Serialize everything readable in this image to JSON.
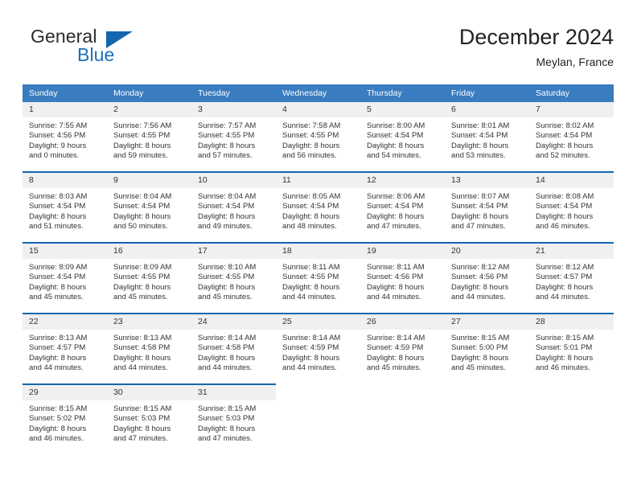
{
  "brand": {
    "word_one": "General",
    "word_two": "Blue",
    "logo_icon": "triangle-logo-icon"
  },
  "header": {
    "title": "December 2024",
    "location": "Meylan, France"
  },
  "colors": {
    "header_blue": "#3a7cc0",
    "rule_blue": "#1466ae",
    "daynum_bg": "#f0f0f0",
    "brand_blue": "#1c6fc0"
  },
  "columns": [
    "Sunday",
    "Monday",
    "Tuesday",
    "Wednesday",
    "Thursday",
    "Friday",
    "Saturday"
  ],
  "weeks": [
    [
      {
        "day": "1",
        "sunrise": "Sunrise: 7:55 AM",
        "sunset": "Sunset: 4:56 PM",
        "daylight_1": "Daylight: 9 hours",
        "daylight_2": "and 0 minutes."
      },
      {
        "day": "2",
        "sunrise": "Sunrise: 7:56 AM",
        "sunset": "Sunset: 4:55 PM",
        "daylight_1": "Daylight: 8 hours",
        "daylight_2": "and 59 minutes."
      },
      {
        "day": "3",
        "sunrise": "Sunrise: 7:57 AM",
        "sunset": "Sunset: 4:55 PM",
        "daylight_1": "Daylight: 8 hours",
        "daylight_2": "and 57 minutes."
      },
      {
        "day": "4",
        "sunrise": "Sunrise: 7:58 AM",
        "sunset": "Sunset: 4:55 PM",
        "daylight_1": "Daylight: 8 hours",
        "daylight_2": "and 56 minutes."
      },
      {
        "day": "5",
        "sunrise": "Sunrise: 8:00 AM",
        "sunset": "Sunset: 4:54 PM",
        "daylight_1": "Daylight: 8 hours",
        "daylight_2": "and 54 minutes."
      },
      {
        "day": "6",
        "sunrise": "Sunrise: 8:01 AM",
        "sunset": "Sunset: 4:54 PM",
        "daylight_1": "Daylight: 8 hours",
        "daylight_2": "and 53 minutes."
      },
      {
        "day": "7",
        "sunrise": "Sunrise: 8:02 AM",
        "sunset": "Sunset: 4:54 PM",
        "daylight_1": "Daylight: 8 hours",
        "daylight_2": "and 52 minutes."
      }
    ],
    [
      {
        "day": "8",
        "sunrise": "Sunrise: 8:03 AM",
        "sunset": "Sunset: 4:54 PM",
        "daylight_1": "Daylight: 8 hours",
        "daylight_2": "and 51 minutes."
      },
      {
        "day": "9",
        "sunrise": "Sunrise: 8:04 AM",
        "sunset": "Sunset: 4:54 PM",
        "daylight_1": "Daylight: 8 hours",
        "daylight_2": "and 50 minutes."
      },
      {
        "day": "10",
        "sunrise": "Sunrise: 8:04 AM",
        "sunset": "Sunset: 4:54 PM",
        "daylight_1": "Daylight: 8 hours",
        "daylight_2": "and 49 minutes."
      },
      {
        "day": "11",
        "sunrise": "Sunrise: 8:05 AM",
        "sunset": "Sunset: 4:54 PM",
        "daylight_1": "Daylight: 8 hours",
        "daylight_2": "and 48 minutes."
      },
      {
        "day": "12",
        "sunrise": "Sunrise: 8:06 AM",
        "sunset": "Sunset: 4:54 PM",
        "daylight_1": "Daylight: 8 hours",
        "daylight_2": "and 47 minutes."
      },
      {
        "day": "13",
        "sunrise": "Sunrise: 8:07 AM",
        "sunset": "Sunset: 4:54 PM",
        "daylight_1": "Daylight: 8 hours",
        "daylight_2": "and 47 minutes."
      },
      {
        "day": "14",
        "sunrise": "Sunrise: 8:08 AM",
        "sunset": "Sunset: 4:54 PM",
        "daylight_1": "Daylight: 8 hours",
        "daylight_2": "and 46 minutes."
      }
    ],
    [
      {
        "day": "15",
        "sunrise": "Sunrise: 8:09 AM",
        "sunset": "Sunset: 4:54 PM",
        "daylight_1": "Daylight: 8 hours",
        "daylight_2": "and 45 minutes."
      },
      {
        "day": "16",
        "sunrise": "Sunrise: 8:09 AM",
        "sunset": "Sunset: 4:55 PM",
        "daylight_1": "Daylight: 8 hours",
        "daylight_2": "and 45 minutes."
      },
      {
        "day": "17",
        "sunrise": "Sunrise: 8:10 AM",
        "sunset": "Sunset: 4:55 PM",
        "daylight_1": "Daylight: 8 hours",
        "daylight_2": "and 45 minutes."
      },
      {
        "day": "18",
        "sunrise": "Sunrise: 8:11 AM",
        "sunset": "Sunset: 4:55 PM",
        "daylight_1": "Daylight: 8 hours",
        "daylight_2": "and 44 minutes."
      },
      {
        "day": "19",
        "sunrise": "Sunrise: 8:11 AM",
        "sunset": "Sunset: 4:56 PM",
        "daylight_1": "Daylight: 8 hours",
        "daylight_2": "and 44 minutes."
      },
      {
        "day": "20",
        "sunrise": "Sunrise: 8:12 AM",
        "sunset": "Sunset: 4:56 PM",
        "daylight_1": "Daylight: 8 hours",
        "daylight_2": "and 44 minutes."
      },
      {
        "day": "21",
        "sunrise": "Sunrise: 8:12 AM",
        "sunset": "Sunset: 4:57 PM",
        "daylight_1": "Daylight: 8 hours",
        "daylight_2": "and 44 minutes."
      }
    ],
    [
      {
        "day": "22",
        "sunrise": "Sunrise: 8:13 AM",
        "sunset": "Sunset: 4:57 PM",
        "daylight_1": "Daylight: 8 hours",
        "daylight_2": "and 44 minutes."
      },
      {
        "day": "23",
        "sunrise": "Sunrise: 8:13 AM",
        "sunset": "Sunset: 4:58 PM",
        "daylight_1": "Daylight: 8 hours",
        "daylight_2": "and 44 minutes."
      },
      {
        "day": "24",
        "sunrise": "Sunrise: 8:14 AM",
        "sunset": "Sunset: 4:58 PM",
        "daylight_1": "Daylight: 8 hours",
        "daylight_2": "and 44 minutes."
      },
      {
        "day": "25",
        "sunrise": "Sunrise: 8:14 AM",
        "sunset": "Sunset: 4:59 PM",
        "daylight_1": "Daylight: 8 hours",
        "daylight_2": "and 44 minutes."
      },
      {
        "day": "26",
        "sunrise": "Sunrise: 8:14 AM",
        "sunset": "Sunset: 4:59 PM",
        "daylight_1": "Daylight: 8 hours",
        "daylight_2": "and 45 minutes."
      },
      {
        "day": "27",
        "sunrise": "Sunrise: 8:15 AM",
        "sunset": "Sunset: 5:00 PM",
        "daylight_1": "Daylight: 8 hours",
        "daylight_2": "and 45 minutes."
      },
      {
        "day": "28",
        "sunrise": "Sunrise: 8:15 AM",
        "sunset": "Sunset: 5:01 PM",
        "daylight_1": "Daylight: 8 hours",
        "daylight_2": "and 46 minutes."
      }
    ],
    [
      {
        "day": "29",
        "sunrise": "Sunrise: 8:15 AM",
        "sunset": "Sunset: 5:02 PM",
        "daylight_1": "Daylight: 8 hours",
        "daylight_2": "and 46 minutes."
      },
      {
        "day": "30",
        "sunrise": "Sunrise: 8:15 AM",
        "sunset": "Sunset: 5:03 PM",
        "daylight_1": "Daylight: 8 hours",
        "daylight_2": "and 47 minutes."
      },
      {
        "day": "31",
        "sunrise": "Sunrise: 8:15 AM",
        "sunset": "Sunset: 5:03 PM",
        "daylight_1": "Daylight: 8 hours",
        "daylight_2": "and 47 minutes."
      },
      {
        "day": "",
        "sunrise": "",
        "sunset": "",
        "daylight_1": "",
        "daylight_2": ""
      },
      {
        "day": "",
        "sunrise": "",
        "sunset": "",
        "daylight_1": "",
        "daylight_2": ""
      },
      {
        "day": "",
        "sunrise": "",
        "sunset": "",
        "daylight_1": "",
        "daylight_2": ""
      },
      {
        "day": "",
        "sunrise": "",
        "sunset": "",
        "daylight_1": "",
        "daylight_2": ""
      }
    ]
  ]
}
